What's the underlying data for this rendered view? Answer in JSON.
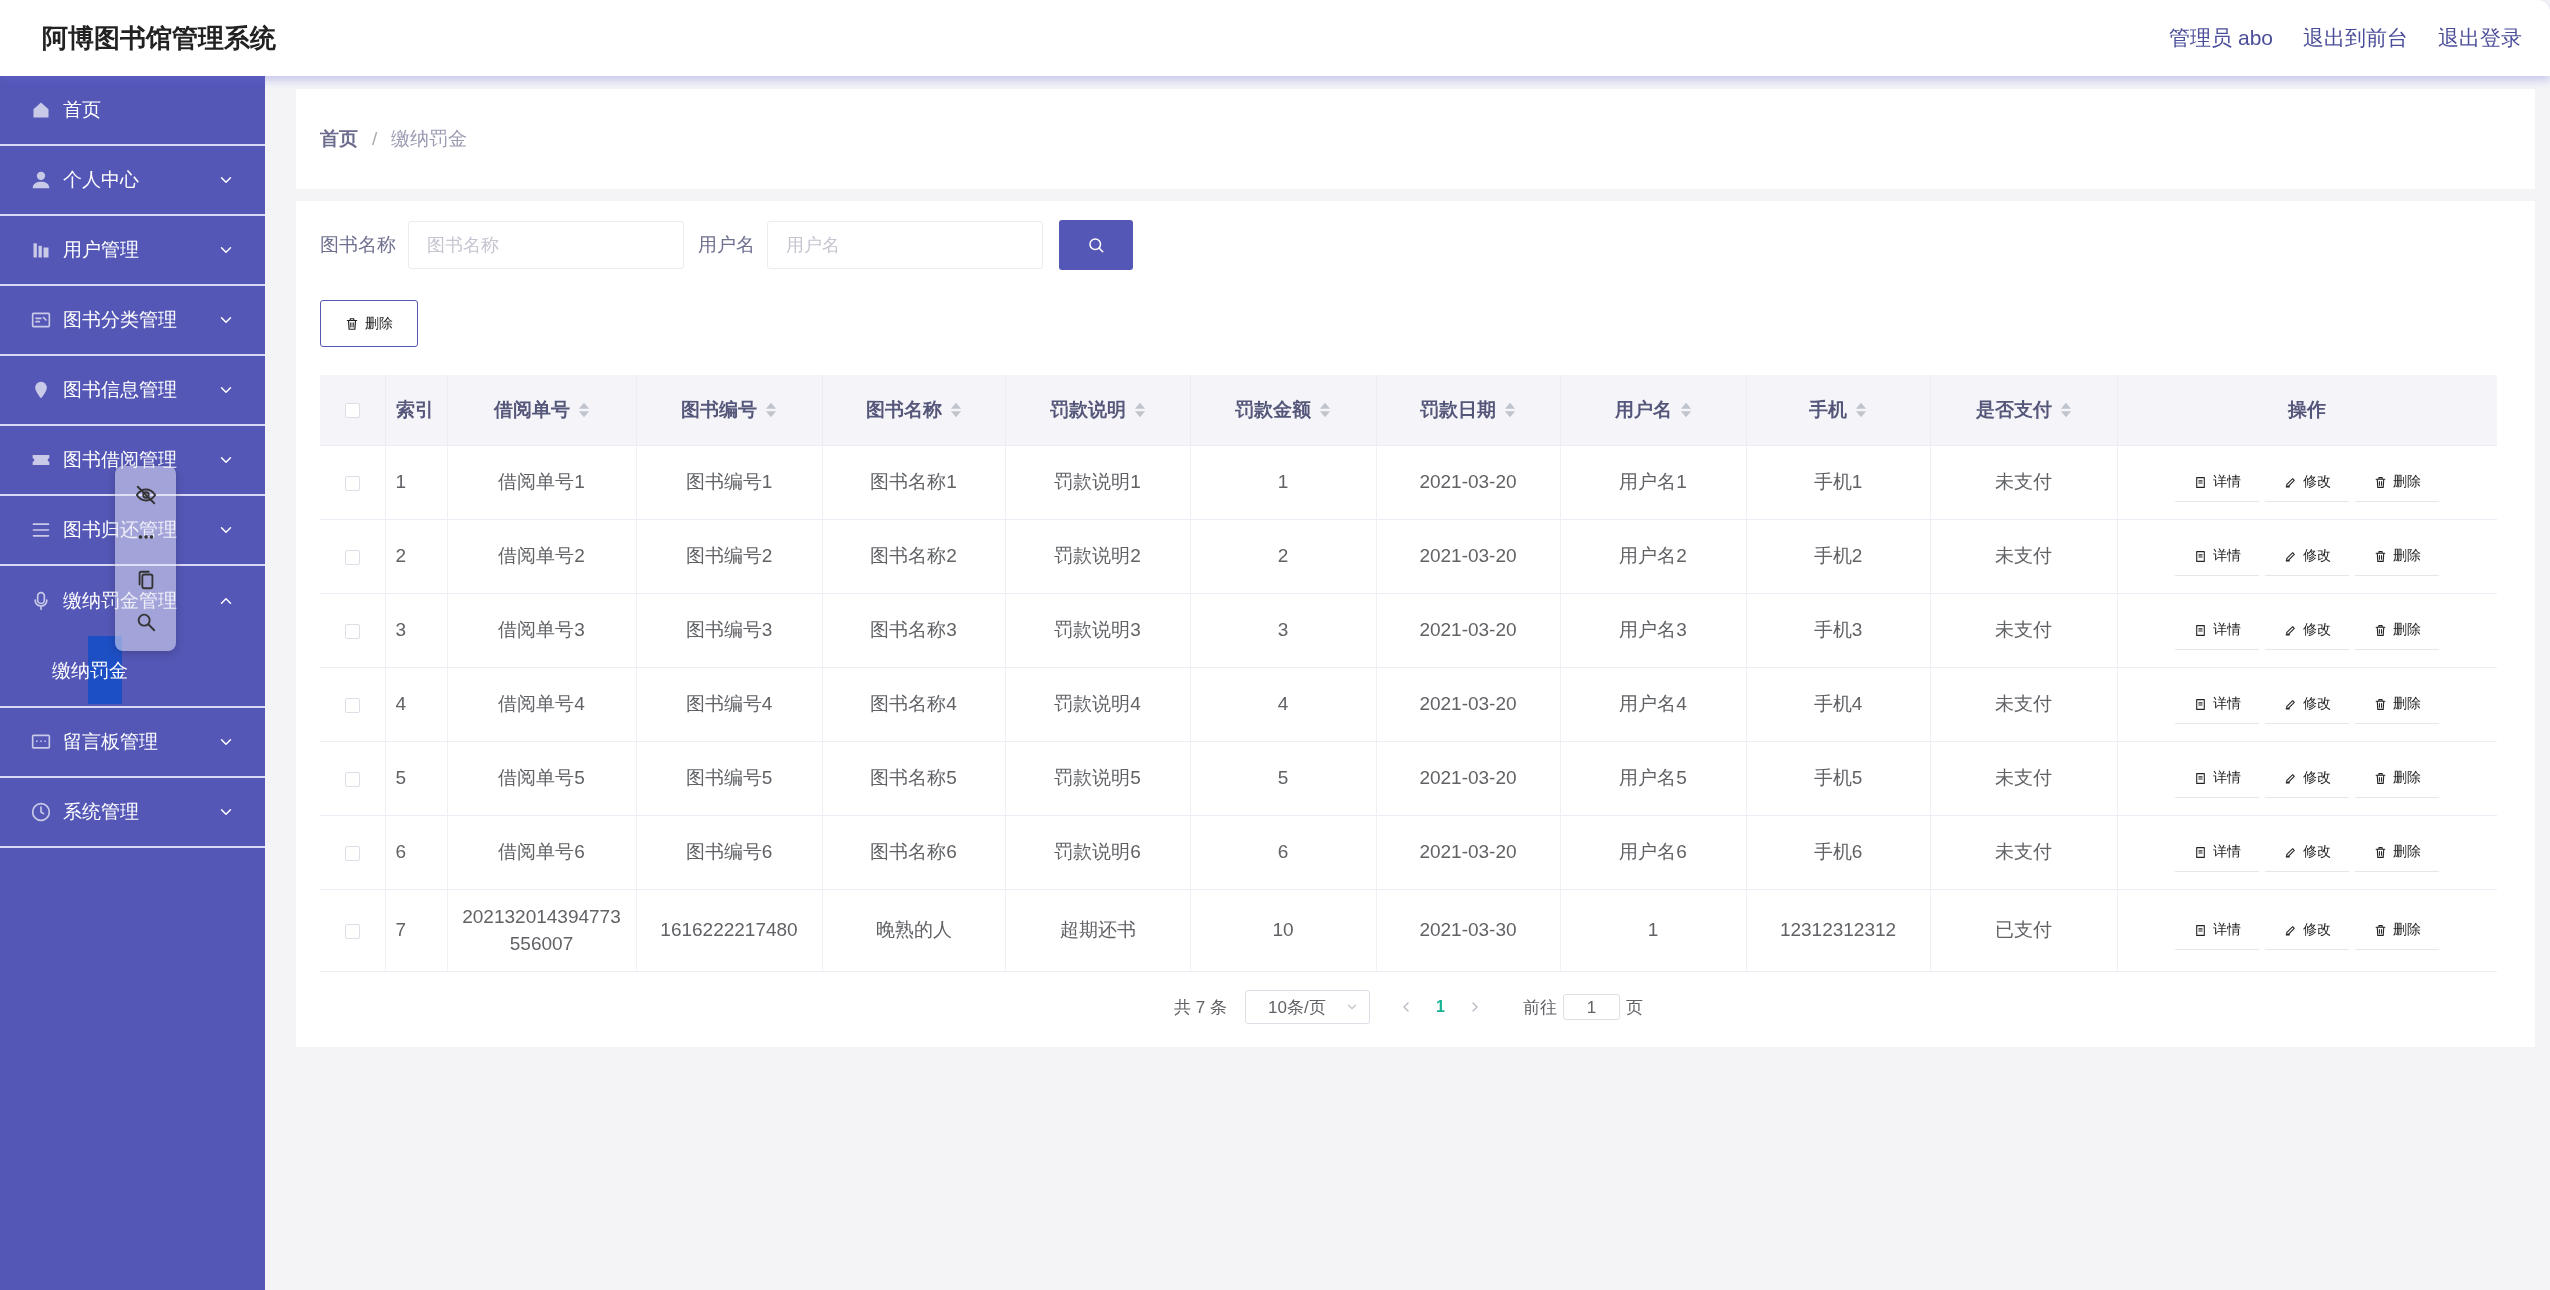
{
  "header": {
    "title": "阿博图书馆管理系统",
    "links": [
      "管理员 abo",
      "退出到前台",
      "退出登录"
    ]
  },
  "sidebar": {
    "items": [
      {
        "label": "首页"
      },
      {
        "label": "个人中心",
        "expanded": false
      },
      {
        "label": "用户管理",
        "expanded": false
      },
      {
        "label": "图书分类管理",
        "expanded": false
      },
      {
        "label": "图书信息管理",
        "expanded": false
      },
      {
        "label": "图书借阅管理",
        "expanded": false
      },
      {
        "label": "图书归还管理",
        "expanded": false
      },
      {
        "label": "缴纳罚金管理",
        "expanded": true,
        "children": [
          {
            "label": "缴纳罚金",
            "selected": true
          }
        ]
      },
      {
        "label": "留言板管理",
        "expanded": false
      },
      {
        "label": "系统管理",
        "expanded": false
      }
    ]
  },
  "breadcrumb": {
    "items": [
      "首页",
      "缴纳罚金"
    ],
    "separator": "/"
  },
  "search": {
    "fields": [
      {
        "label": "图书名称",
        "placeholder": "图书名称"
      },
      {
        "label": "用户名",
        "placeholder": "用户名"
      }
    ]
  },
  "toolbar": {
    "delete_button": "删除"
  },
  "table": {
    "select_all": {
      "checked": false
    },
    "columns": [
      {
        "label": "索引",
        "sortable": false
      },
      {
        "label": "借阅单号",
        "sortable": true
      },
      {
        "label": "图书编号",
        "sortable": true
      },
      {
        "label": "图书名称",
        "sortable": true
      },
      {
        "label": "罚款说明",
        "sortable": true
      },
      {
        "label": "罚款金额",
        "sortable": true
      },
      {
        "label": "罚款日期",
        "sortable": true
      },
      {
        "label": "用户名",
        "sortable": true
      },
      {
        "label": "手机",
        "sortable": true
      },
      {
        "label": "是否支付",
        "sortable": true
      },
      {
        "label": "操作",
        "sortable": false
      }
    ],
    "rows": [
      {
        "checked": false,
        "cells": [
          "1",
          "借阅单号1",
          "图书编号1",
          "图书名称1",
          "罚款说明1",
          "1",
          "2021-03-20",
          "用户名1",
          "手机1",
          "未支付"
        ],
        "actions": [
          "详情",
          "修改",
          "删除"
        ]
      },
      {
        "checked": false,
        "cells": [
          "2",
          "借阅单号2",
          "图书编号2",
          "图书名称2",
          "罚款说明2",
          "2",
          "2021-03-20",
          "用户名2",
          "手机2",
          "未支付"
        ],
        "actions": [
          "详情",
          "修改",
          "删除"
        ]
      },
      {
        "checked": false,
        "cells": [
          "3",
          "借阅单号3",
          "图书编号3",
          "图书名称3",
          "罚款说明3",
          "3",
          "2021-03-20",
          "用户名3",
          "手机3",
          "未支付"
        ],
        "actions": [
          "详情",
          "修改",
          "删除"
        ]
      },
      {
        "checked": false,
        "cells": [
          "4",
          "借阅单号4",
          "图书编号4",
          "图书名称4",
          "罚款说明4",
          "4",
          "2021-03-20",
          "用户名4",
          "手机4",
          "未支付"
        ],
        "actions": [
          "详情",
          "修改",
          "删除"
        ]
      },
      {
        "checked": false,
        "cells": [
          "5",
          "借阅单号5",
          "图书编号5",
          "图书名称5",
          "罚款说明5",
          "5",
          "2021-03-20",
          "用户名5",
          "手机5",
          "未支付"
        ],
        "actions": [
          "详情",
          "修改",
          "删除"
        ]
      },
      {
        "checked": false,
        "cells": [
          "6",
          "借阅单号6",
          "图书编号6",
          "图书名称6",
          "罚款说明6",
          "6",
          "2021-03-20",
          "用户名6",
          "手机6",
          "未支付"
        ],
        "actions": [
          "详情",
          "修改",
          "删除"
        ]
      },
      {
        "checked": false,
        "cells": [
          "7",
          "202132014394773556007",
          "1616222217480",
          "晚熟的人",
          "超期还书",
          "10",
          "2021-03-30",
          "1",
          "12312312312",
          "已支付"
        ],
        "actions": [
          "详情",
          "修改",
          "删除"
        ]
      }
    ]
  },
  "pagination": {
    "total": "共 7 条",
    "page_size": "10条/页",
    "pages": [
      {
        "label": "1",
        "selected": true
      }
    ],
    "goto_label": "前往",
    "goto_value": "1",
    "goto_suffix": "页"
  }
}
